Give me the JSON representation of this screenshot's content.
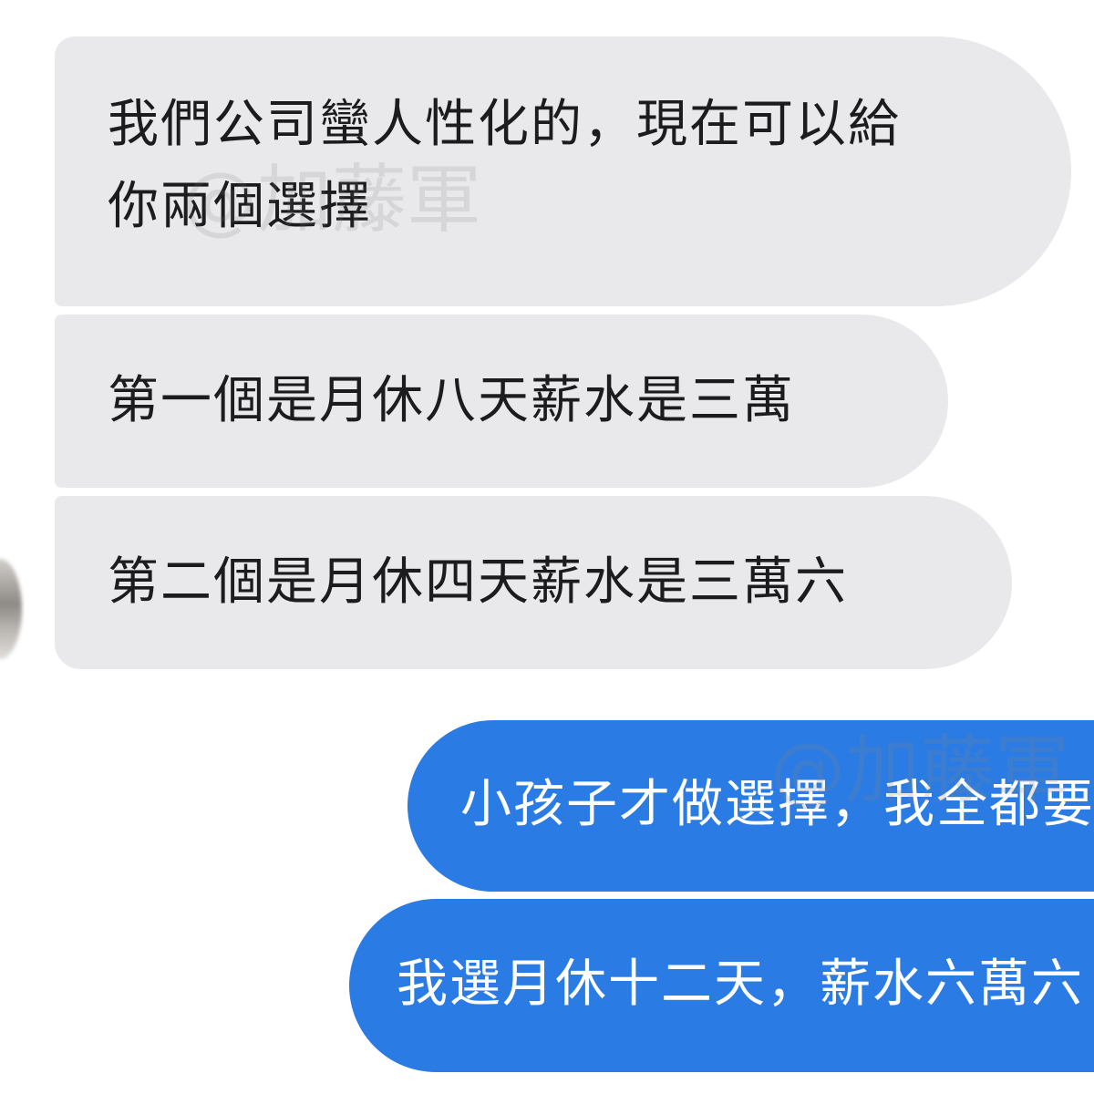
{
  "messages": [
    {
      "direction": "incoming",
      "lines": [
        "我們公司蠻人性化的，現在可以給",
        "你兩個選擇"
      ]
    },
    {
      "direction": "incoming",
      "text": "第一個是月休八天薪水是三萬"
    },
    {
      "direction": "incoming",
      "text": "第二個是月休四天薪水是三萬六"
    },
    {
      "direction": "outgoing",
      "text": "小孩子才做選擇，我全都要"
    },
    {
      "direction": "outgoing",
      "text": "我選月休十二天，薪水六萬六"
    }
  ],
  "watermark": {
    "text": "@加藤軍"
  },
  "colors": {
    "incoming_bubble": "#e9e9eb",
    "incoming_text": "#1c1c1e",
    "outgoing_bubble": "#2a7be4",
    "outgoing_text": "#ffffff"
  },
  "icons": {
    "avatar": "blurred-user-avatar"
  }
}
